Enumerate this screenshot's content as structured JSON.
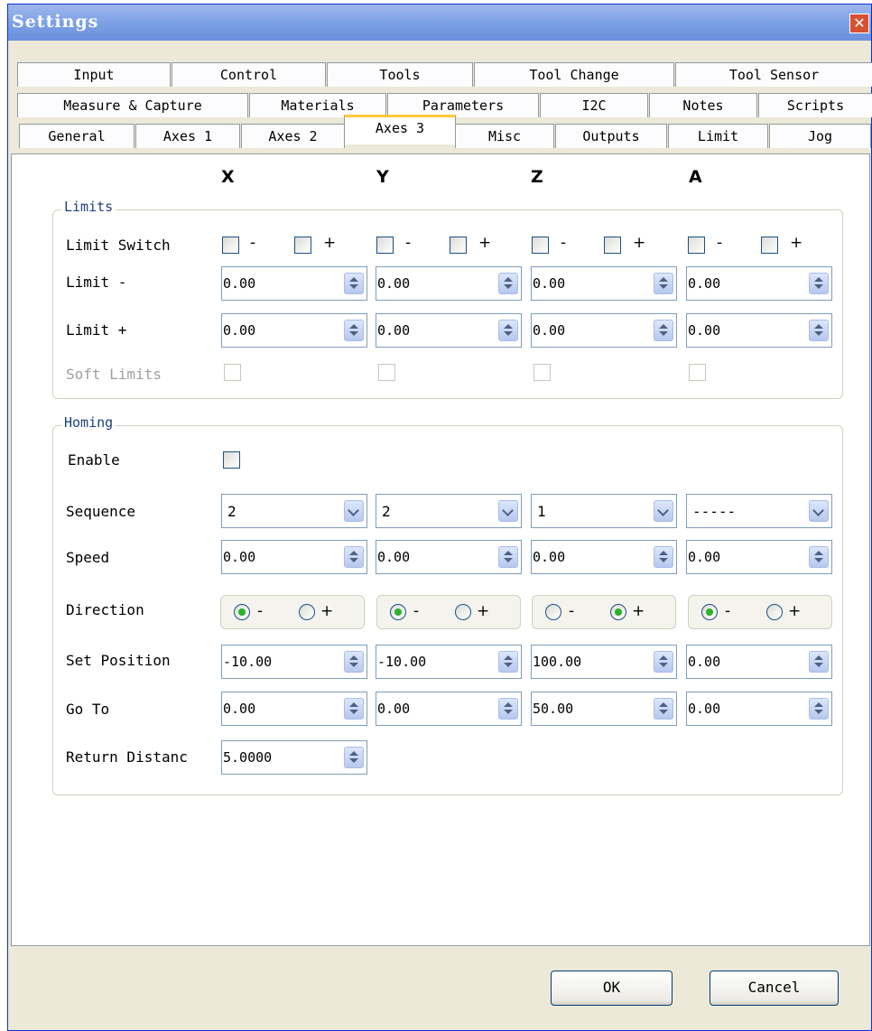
{
  "window": {
    "title": "Settings",
    "close": "✕"
  },
  "tabs": {
    "row1": [
      "Input",
      "Control",
      "Tools",
      "Tool Change",
      "Tool Sensor"
    ],
    "row2": [
      "Measure & Capture",
      "Materials",
      "Parameters",
      "I2C",
      "Notes",
      "Scripts"
    ],
    "row3": [
      "General",
      "Axes 1",
      "Axes 2",
      "Axes 3",
      "Misc",
      "Outputs",
      "Limit",
      "Jog"
    ],
    "active": "Axes 3"
  },
  "columns": [
    "X",
    "Y",
    "Z",
    "A"
  ],
  "limits": {
    "title": "Limits",
    "limit_switch_label": "Limit Switch",
    "minus_sign": "-",
    "plus_sign": "+",
    "limit_minus_label": "Limit -",
    "limit_plus_label": "Limit +",
    "soft_limits_label": "Soft Limits",
    "limit_minus": [
      "0.00",
      "0.00",
      "0.00",
      "0.00"
    ],
    "limit_plus": [
      "0.00",
      "0.00",
      "0.00",
      "0.00"
    ]
  },
  "homing": {
    "title": "Homing",
    "enable_label": "Enable",
    "sequence_label": "Sequence",
    "sequence": [
      "2",
      "2",
      "1",
      "-----"
    ],
    "speed_label": "Speed",
    "speed": [
      "0.00",
      "0.00",
      "0.00",
      "0.00"
    ],
    "direction_label": "Direction",
    "direction": [
      "-",
      "-",
      "+",
      "-"
    ],
    "set_position_label": "Set Position",
    "set_position": [
      "-10.00",
      "-10.00",
      "100.00",
      "0.00"
    ],
    "go_to_label": "Go To",
    "go_to": [
      "0.00",
      "0.00",
      "50.00",
      "0.00"
    ],
    "return_distance_label": "Return Distanc",
    "return_distance": "5.0000"
  },
  "buttons": {
    "ok": "OK",
    "cancel": "Cancel"
  }
}
